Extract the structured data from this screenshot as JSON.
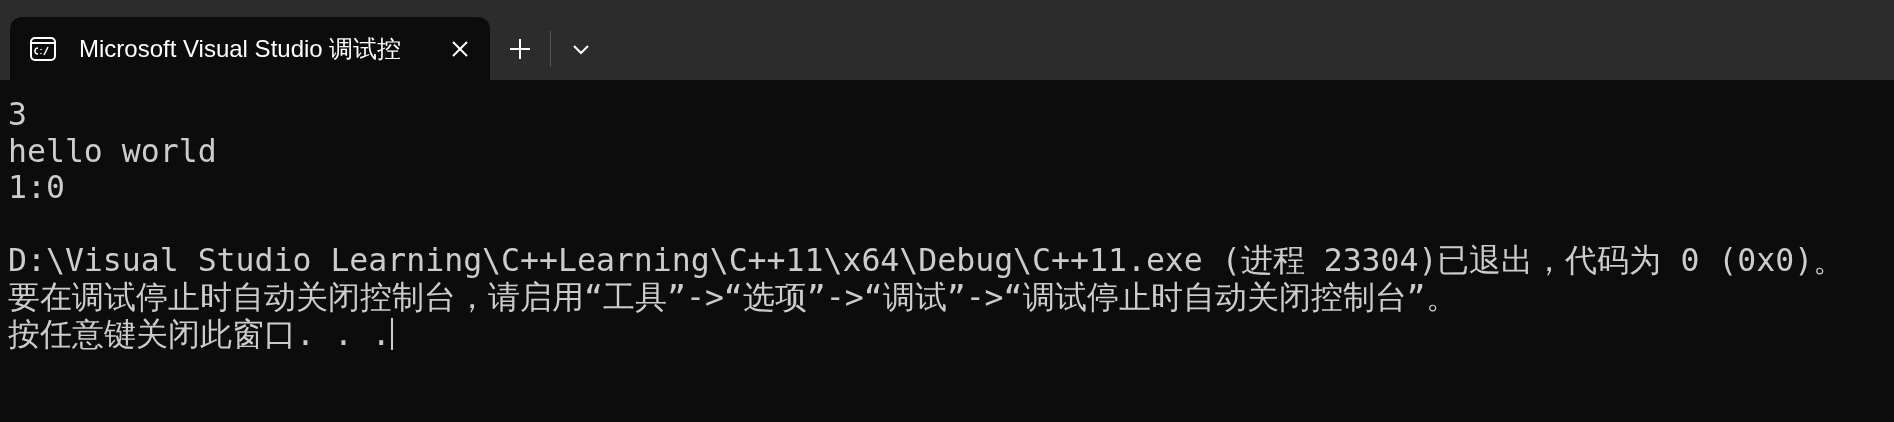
{
  "tabs": [
    {
      "title": "Microsoft Visual Studio 调试控",
      "selected": true
    }
  ],
  "console": {
    "blocks": [
      [
        "3",
        "hello world",
        "1:0"
      ],
      [
        "D:\\Visual Studio Learning\\C++Learning\\C++11\\x64\\Debug\\C++11.exe (进程 23304)已退出，代码为 0 (0x0)。",
        "要在调试停止时自动关闭控制台，请启用“工具”->“选项”->“调试”->“调试停止时自动关闭控制台”。",
        "按任意键关闭此窗口. . ."
      ]
    ],
    "cursor_visible": true
  }
}
